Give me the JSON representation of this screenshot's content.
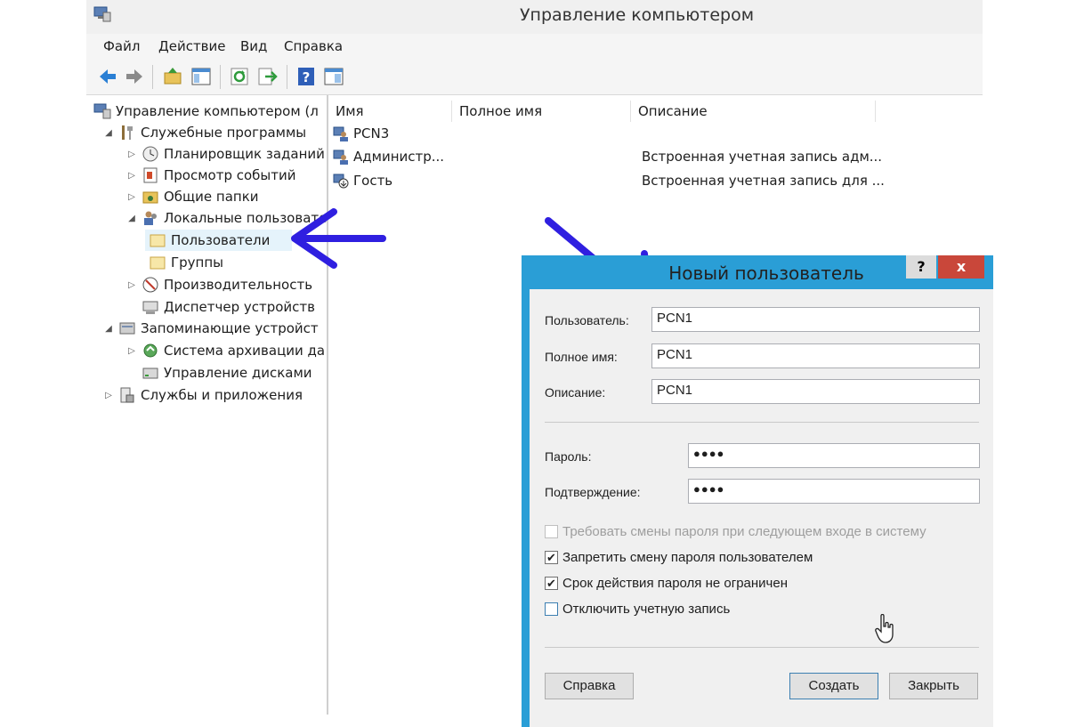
{
  "window": {
    "title": "Управление компьютером"
  },
  "menu": [
    "Файл",
    "Действие",
    "Вид",
    "Справка"
  ],
  "toolbar": [
    "back-icon",
    "forward-icon",
    "up-folder-icon",
    "show-tree-icon",
    "refresh-icon",
    "export-icon",
    "help-icon",
    "properties-icon"
  ],
  "tree": [
    {
      "label": "Управление компьютером (л",
      "icon": "computer-icon"
    },
    {
      "label": "Служебные программы",
      "icon": "tools-icon"
    },
    {
      "label": "Планировщик заданий",
      "icon": "clock-icon"
    },
    {
      "label": "Просмотр событий",
      "icon": "event-viewer-icon"
    },
    {
      "label": "Общие папки",
      "icon": "shared-folder-icon"
    },
    {
      "label": "Локальные пользовате",
      "icon": "users-icon"
    },
    {
      "label": "Пользователи",
      "icon": "folder-icon"
    },
    {
      "label": "Группы",
      "icon": "folder-icon"
    },
    {
      "label": "Производительность",
      "icon": "performance-icon"
    },
    {
      "label": "Диспетчер устройств",
      "icon": "device-manager-icon"
    },
    {
      "label": "Запоминающие устройст",
      "icon": "storage-icon"
    },
    {
      "label": "Система архивации да",
      "icon": "backup-icon"
    },
    {
      "label": "Управление дисками",
      "icon": "disk-icon"
    },
    {
      "label": "Службы и приложения",
      "icon": "services-icon"
    }
  ],
  "list": {
    "columns": [
      "Имя",
      "Полное имя",
      "Описание"
    ],
    "rows": [
      {
        "name": "PCN3",
        "fullname": "",
        "description": ""
      },
      {
        "name": "Администр...",
        "fullname": "",
        "description": "Встроенная учетная запись адм..."
      },
      {
        "name": "Гость",
        "fullname": "",
        "description": "Встроенная учетная запись для ..."
      }
    ]
  },
  "dialog": {
    "title": "Новый пользователь",
    "help_glyph": "?",
    "close_glyph": "x",
    "user_label": "Пользователь:",
    "user_value": "PCN1",
    "fullname_label": "Полное имя:",
    "fullname_value": "PCN1",
    "description_label": "Описание:",
    "description_value": "PCN1",
    "password_label": "Пароль:",
    "password_value": "●●●●",
    "confirm_label": "Подтверждение:",
    "confirm_value": "●●●●",
    "checks": [
      {
        "label": "Требовать смены пароля при следующем входе в систему",
        "checked": false,
        "disabled": true
      },
      {
        "label": "Запретить смену пароля пользователем",
        "checked": true,
        "disabled": false
      },
      {
        "label": "Срок действия пароля не ограничен",
        "checked": true,
        "disabled": false
      },
      {
        "label": "Отключить учетную запись",
        "checked": false,
        "disabled": false
      }
    ],
    "btn_help": "Справка",
    "btn_create": "Создать",
    "btn_close": "Закрыть"
  },
  "colors": {
    "accent": "#2a9ed6",
    "close": "#c9473a",
    "annotation_arrow": "#2f1fe0"
  }
}
